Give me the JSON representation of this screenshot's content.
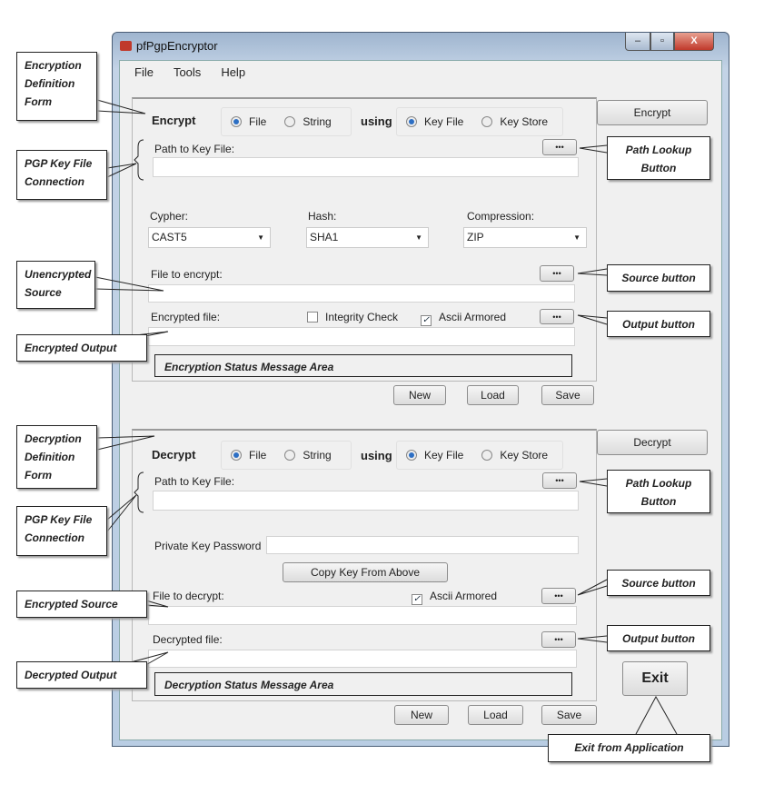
{
  "window": {
    "title": "pfPgpEncryptor",
    "min": "–",
    "max": "▫",
    "close": "X"
  },
  "menu": [
    "File",
    "Tools",
    "Help"
  ],
  "encrypt": {
    "heading": "Encrypt",
    "src_options": [
      "File",
      "String"
    ],
    "using": "using",
    "key_options": [
      "Key File",
      "Key Store"
    ],
    "action": "Encrypt",
    "path_label": "Path to Key File:",
    "browse": "•••",
    "cypher_label": "Cypher:",
    "cypher": "CAST5",
    "hash_label": "Hash:",
    "hash": "SHA1",
    "compression_label": "Compression:",
    "compression": "ZIP",
    "file_label": "File to encrypt:",
    "out_label": "Encrypted file:",
    "integrity": "Integrity Check",
    "integrity_checked": false,
    "ascii": "Ascii Armored",
    "ascii_checked": true,
    "status": "Encryption Status Message Area",
    "new": "New",
    "load": "Load",
    "save": "Save"
  },
  "decrypt": {
    "heading": "Decrypt",
    "src_options": [
      "File",
      "String"
    ],
    "using": "using",
    "key_options": [
      "Key File",
      "Key Store"
    ],
    "action": "Decrypt",
    "path_label": "Path to Key File:",
    "browse": "•••",
    "pw_label": "Private Key Password",
    "copy": "Copy Key From Above",
    "file_label": "File to decrypt:",
    "ascii": "Ascii Armored",
    "ascii_checked": true,
    "out_label": "Decrypted file:",
    "status": "Decryption Status Message Area",
    "new": "New",
    "load": "Load",
    "save": "Save",
    "exit": "Exit"
  },
  "callouts": {
    "enc_form": "Encryption Definition Form",
    "pgp1": "PGP Key File Connection",
    "unenc": "Unencrypted Source",
    "enc_out": "Encrypted Output",
    "dec_form": "Decryption Definition Form",
    "pgp2": "PGP Key File Connection",
    "enc_src": "Encrypted Source",
    "dec_out": "Decrypted Output",
    "path1": "Path Lookup Button",
    "src1": "Source button",
    "out1": "Output button",
    "path2": "Path Lookup Button",
    "src2": "Source button",
    "out2": "Output button",
    "exit": "Exit from Application"
  }
}
